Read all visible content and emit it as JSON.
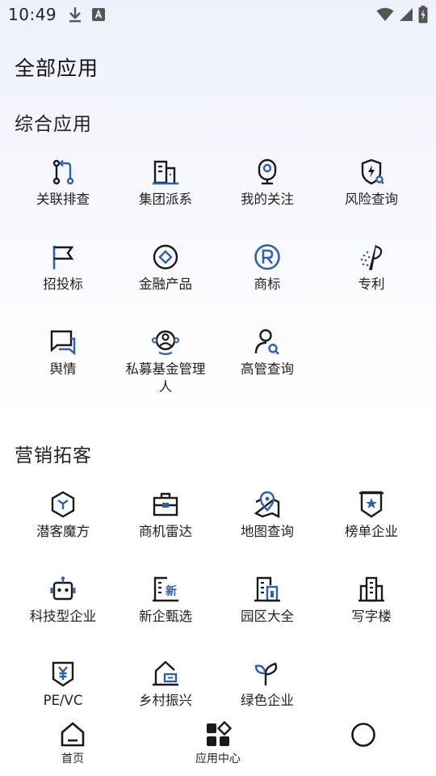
{
  "status_bar": {
    "time": "10:49",
    "left_icons": [
      "download-icon",
      "font-a-icon"
    ],
    "right_icons": [
      "wifi-icon",
      "signal-icon",
      "battery-icon"
    ]
  },
  "header": {
    "title": "全部应用"
  },
  "colors": {
    "accent": "#2f5fb3",
    "ink": "#1a1a1a"
  },
  "sections": [
    {
      "title": "综合应用",
      "items": [
        {
          "label": "关联排查",
          "icon": "relation-branch-icon"
        },
        {
          "label": "集团派系",
          "icon": "building-group-icon"
        },
        {
          "label": "我的关注",
          "icon": "webcam-follow-icon"
        },
        {
          "label": "风险查询",
          "icon": "shield-search-icon"
        },
        {
          "label": "招投标",
          "icon": "flag-icon"
        },
        {
          "label": "金融产品",
          "icon": "diamond-circle-icon"
        },
        {
          "label": "商标",
          "icon": "registered-icon"
        },
        {
          "label": "专利",
          "icon": "patent-icon"
        },
        {
          "label": "舆情",
          "icon": "chat-bubble-icon"
        },
        {
          "label": "私募基金管理人",
          "icon": "fund-manager-icon"
        },
        {
          "label": "高管查询",
          "icon": "person-search-icon"
        }
      ]
    },
    {
      "title": "营销拓客",
      "items": [
        {
          "label": "潜客魔方",
          "icon": "cube-icon"
        },
        {
          "label": "商机雷达",
          "icon": "briefcase-icon"
        },
        {
          "label": "地图查询",
          "icon": "map-pin-icon"
        },
        {
          "label": "榜单企业",
          "icon": "ranking-badge-icon"
        },
        {
          "label": "科技型企业",
          "icon": "robot-icon"
        },
        {
          "label": "新企甄选",
          "icon": "new-company-icon"
        },
        {
          "label": "园区大全",
          "icon": "park-building-icon"
        },
        {
          "label": "写字楼",
          "icon": "office-tower-icon"
        },
        {
          "label": "PE/VC",
          "icon": "yen-shield-icon"
        },
        {
          "label": "乡村振兴",
          "icon": "village-house-icon"
        },
        {
          "label": "绿色企业",
          "icon": "sprout-icon"
        }
      ]
    }
  ],
  "bottom_nav": [
    {
      "label": "首页",
      "icon": "home-icon"
    },
    {
      "label": "应用中心",
      "icon": "apps-grid-icon"
    },
    {
      "label": "",
      "icon": "circle-icon"
    }
  ]
}
